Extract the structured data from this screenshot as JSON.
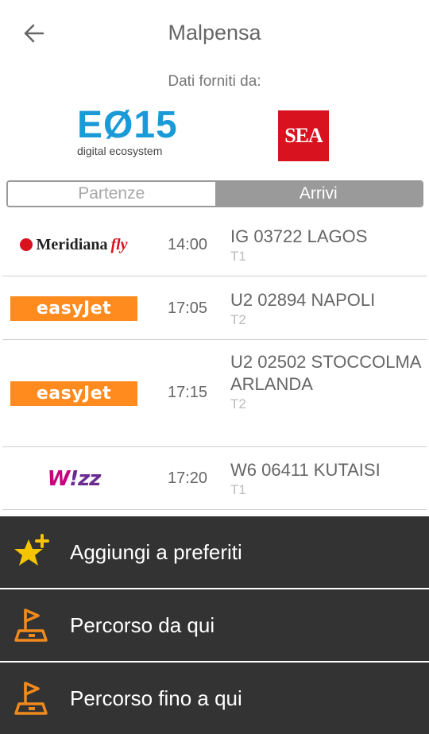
{
  "header": {
    "title": "Malpensa"
  },
  "providers": {
    "caption": "Dati forniti da:",
    "e015": {
      "name": "EØ15",
      "tagline": "digital ecosystem"
    },
    "sea": {
      "name": "SEA"
    }
  },
  "tabs": [
    {
      "label": "Partenze",
      "active": false
    },
    {
      "label": "Arrivi",
      "active": true
    }
  ],
  "flights": [
    {
      "airline": "Meridiana fly",
      "airline_a": "Meridiana",
      "airline_b": "fly",
      "time": "14:00",
      "flight": "IG 03722 LAGOS",
      "terminal": "T1"
    },
    {
      "airline": "easyJet",
      "time": "17:05",
      "flight": "U2 02894 NAPOLI",
      "terminal": "T2"
    },
    {
      "airline": "easyJet",
      "time": "17:15",
      "flight": "U2 02502 STOCCOLMA ARLANDA",
      "terminal": "T2"
    },
    {
      "airline": "Wizz",
      "airline_a": "W",
      "airline_b": "!zz",
      "time": "17:20",
      "flight": "W6 06411 KUTAISI",
      "terminal": "T1"
    }
  ],
  "actions": [
    {
      "label": "Aggiungi a preferiti",
      "icon": "star-add-icon"
    },
    {
      "label": "Percorso da qui",
      "icon": "route-from-icon"
    },
    {
      "label": "Percorso fino a qui",
      "icon": "route-to-icon"
    }
  ],
  "colors": {
    "easyjet": "#ff8a1e",
    "sea": "#d8121f",
    "e015": "#1a9ad6",
    "menu_bg": "#333333",
    "star": "#f5c400",
    "route": "#f08a1c"
  }
}
